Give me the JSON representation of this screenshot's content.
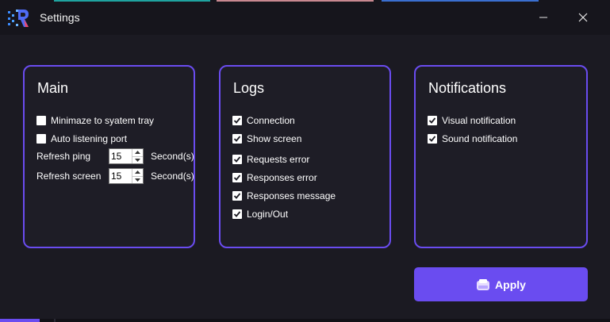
{
  "window": {
    "title": "Settings",
    "accent_color": "#6a4cf0"
  },
  "titlebar": {
    "minimize_icon": "minimize-icon",
    "close_icon": "close-icon"
  },
  "main_panel": {
    "title": "Main",
    "checkboxes": [
      {
        "label": "Minimaze to syatem tray",
        "checked": false
      },
      {
        "label": "Auto listening port",
        "checked": false
      }
    ],
    "refresh_ping": {
      "label": "Refresh ping",
      "value": "15",
      "unit": "Second(s)"
    },
    "refresh_screen": {
      "label": "Refresh screen",
      "value": "15",
      "unit": "Second(s)"
    }
  },
  "logs_panel": {
    "title": "Logs",
    "checkboxes": [
      {
        "label": "Connection",
        "checked": true
      },
      {
        "label": "Show screen",
        "checked": true
      },
      {
        "label": "Requests error",
        "checked": true
      },
      {
        "label": "Responses error",
        "checked": true
      },
      {
        "label": "Responses message",
        "checked": true
      },
      {
        "label": "Login/Out",
        "checked": true
      }
    ]
  },
  "notifications_panel": {
    "title": "Notifications",
    "checkboxes": [
      {
        "label": "Visual notification",
        "checked": true
      },
      {
        "label": "Sound notification",
        "checked": true
      }
    ]
  },
  "apply_button": {
    "label": "Apply",
    "icon": "save-disk-icon"
  }
}
